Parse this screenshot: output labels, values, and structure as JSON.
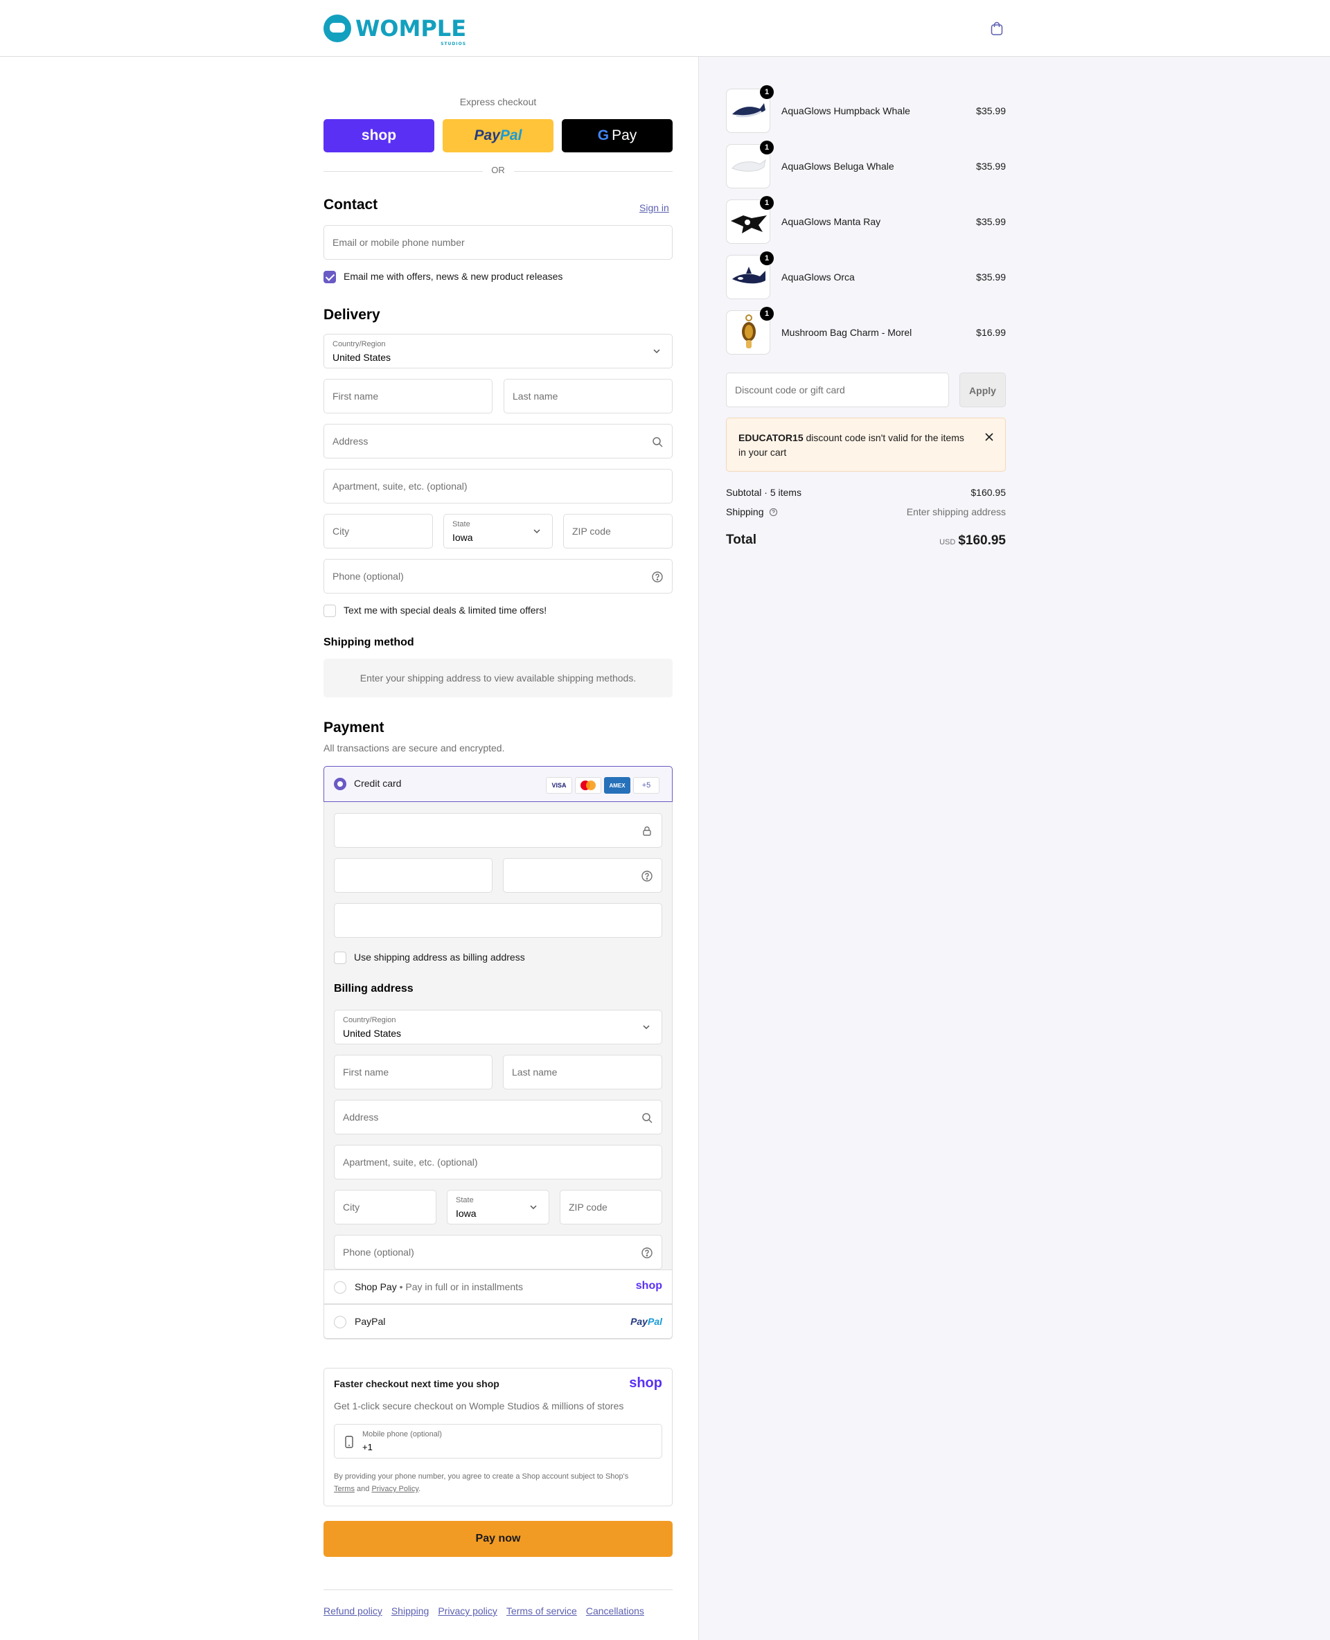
{
  "brand": {
    "name": "WOMPLE",
    "sub": "STUDIOS",
    "color": "#13a0bf"
  },
  "header": {
    "cart_icon": "shopping-bag-icon"
  },
  "express": {
    "label": "Express checkout",
    "shop": "shop",
    "paypal_pay": "Pay",
    "paypal_pal": "Pal",
    "gpay_g": "G",
    "gpay_pay": "Pay",
    "or": "OR"
  },
  "contact": {
    "title": "Contact",
    "sign_in": "Sign in",
    "email_placeholder": "Email or mobile phone number",
    "email_offers": "Email me with offers, news & new product releases",
    "email_offers_checked": true
  },
  "delivery": {
    "title": "Delivery",
    "country_label": "Country/Region",
    "country_value": "United States",
    "first_name": "First name",
    "last_name": "Last name",
    "address": "Address",
    "apartment": "Apartment, suite, etc. (optional)",
    "city": "City",
    "state_label": "State",
    "state_value": "Iowa",
    "zip": "ZIP code",
    "phone": "Phone (optional)",
    "text_offers": "Text me with special deals & limited time offers!"
  },
  "shipping": {
    "title": "Shipping method",
    "notice": "Enter your shipping address to view available shipping methods."
  },
  "payment": {
    "title": "Payment",
    "subtitle": "All transactions are secure and encrypted.",
    "credit_card": "Credit card",
    "cards": [
      "VISA",
      "MC",
      "AMEX",
      "+5"
    ],
    "use_shipping": "Use shipping address as billing address",
    "billing_title": "Billing address",
    "billing": {
      "country_label": "Country/Region",
      "country_value": "United States",
      "first_name": "First name",
      "last_name": "Last name",
      "address": "Address",
      "apartment": "Apartment, suite, etc. (optional)",
      "city": "City",
      "state_label": "State",
      "state_value": "Iowa",
      "zip": "ZIP code",
      "phone": "Phone (optional)"
    },
    "shop_pay": "Shop Pay",
    "shop_pay_sep": "•",
    "shop_pay_sub": "Pay in full or in installments",
    "shop_pay_brand": "shop",
    "paypal": "PayPal",
    "paypal_brand_pay": "Pay",
    "paypal_brand_pal": "Pal"
  },
  "shop_promo": {
    "title": "Faster checkout next time you shop",
    "brand": "shop",
    "text": "Get 1-click secure checkout on Womple Studios & millions of stores",
    "phone_label": "Mobile phone (optional)",
    "phone_value": "+1",
    "legal_1": "By providing your phone number, you agree to create a Shop account subject to Shop's",
    "terms": "Terms",
    "and": "and",
    "privacy": "Privacy Policy",
    "period": "."
  },
  "pay_now": "Pay now",
  "footer": [
    "Refund policy",
    "Shipping",
    "Privacy policy",
    "Terms of service",
    "Cancellations"
  ],
  "cart": {
    "items": [
      {
        "name": "AquaGlows Humpback Whale",
        "price": "$35.99",
        "qty": "1"
      },
      {
        "name": "AquaGlows Beluga Whale",
        "price": "$35.99",
        "qty": "1"
      },
      {
        "name": "AquaGlows Manta Ray",
        "price": "$35.99",
        "qty": "1"
      },
      {
        "name": "AquaGlows Orca",
        "price": "$35.99",
        "qty": "1"
      },
      {
        "name": "Mushroom Bag Charm - Morel",
        "price": "$16.99",
        "qty": "1"
      }
    ],
    "discount_placeholder": "Discount code or gift card",
    "apply": "Apply",
    "warning_code": "EDUCATOR15",
    "warning_text": " discount code isn't valid for the items in your cart",
    "subtotal_label": "Subtotal · 5 items",
    "subtotal_value": "$160.95",
    "shipping_label": "Shipping",
    "shipping_value": "Enter shipping address",
    "total_label": "Total",
    "currency": "USD",
    "total_value": "$160.95"
  },
  "colors": {
    "accent": "#6a5ac5",
    "shop": "#5a31f4",
    "pay_now": "#f29b24",
    "paypal": "#ffc439",
    "warning_bg": "#fff4e8"
  }
}
